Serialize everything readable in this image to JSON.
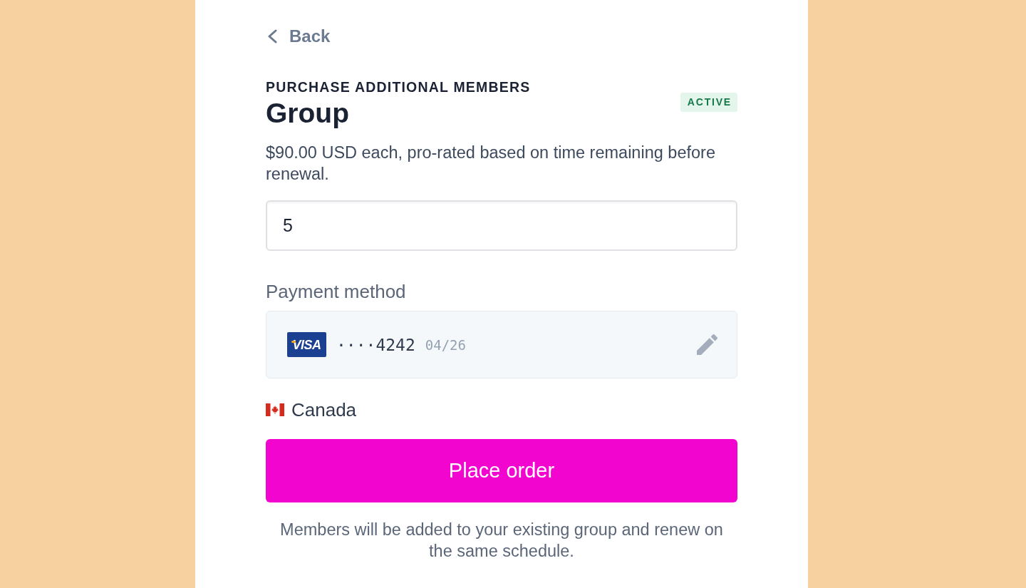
{
  "back_link": {
    "label": "Back"
  },
  "header": {
    "eyebrow": "PURCHASE ADDITIONAL MEMBERS",
    "title": "Group",
    "status_badge": "ACTIVE"
  },
  "description": "$90.00 USD each, pro-rated based on time remaining before renewal.",
  "quantity_field": {
    "value": "5"
  },
  "payment": {
    "label": "Payment method",
    "card": {
      "brand": "VISA",
      "number": "····4242",
      "expiry": "04/26"
    }
  },
  "country": {
    "name": "Canada"
  },
  "submit_button": {
    "label": "Place order"
  },
  "footnote": "Members will be added to your existing group and renew on the same schedule."
}
